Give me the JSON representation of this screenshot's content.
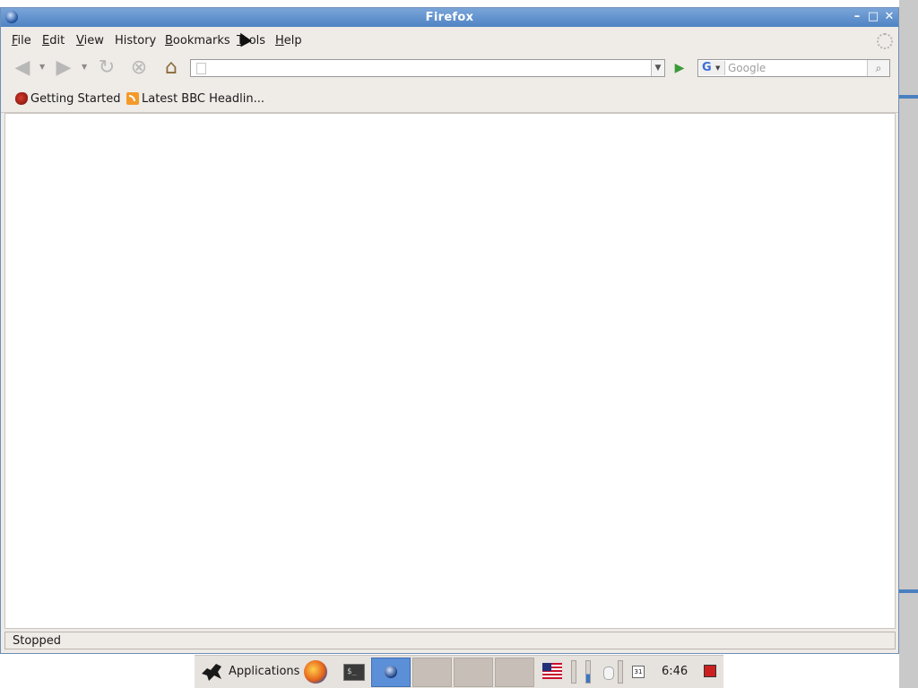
{
  "window": {
    "title": "Firefox"
  },
  "menubar": {
    "items": [
      {
        "label": "File",
        "accel": "F",
        "rest": "ile"
      },
      {
        "label": "Edit",
        "accel": "E",
        "rest": "dit"
      },
      {
        "label": "View",
        "accel": "V",
        "rest": "iew"
      },
      {
        "label": "History",
        "accel": "",
        "rest": "History"
      },
      {
        "label": "Bookmarks",
        "accel": "B",
        "rest": "ookmarks"
      },
      {
        "label": "Tools",
        "accel": "T",
        "rest": "ools"
      },
      {
        "label": "Help",
        "accel": "H",
        "rest": "elp"
      }
    ]
  },
  "navbar": {
    "back_icon": "back-arrow-icon",
    "forward_icon": "forward-arrow-icon",
    "reload_icon": "reload-icon",
    "stop_icon": "stop-icon",
    "home_icon": "home-icon",
    "url_value": "",
    "search_placeholder": "Google",
    "search_engine": "G"
  },
  "bookmarks": {
    "items": [
      {
        "label": "Getting Started",
        "icon": "firefox-bookmark-icon"
      },
      {
        "label": "Latest BBC Headlin...",
        "icon": "rss-feed-icon"
      }
    ]
  },
  "status": {
    "text": "Stopped"
  },
  "taskbar": {
    "applications_label": "Applications",
    "clock": "6:46",
    "calendar_day": "31",
    "terminal_glyph": "$_"
  },
  "colors": {
    "title_bar": "#5a8cc9",
    "taskbar_active": "#5b8fd8",
    "go_arrow": "#3a9a3a"
  }
}
